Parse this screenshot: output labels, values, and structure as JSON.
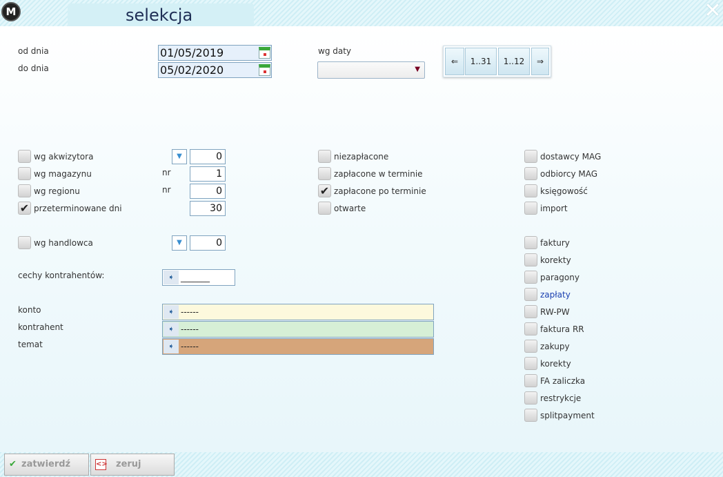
{
  "window": {
    "title": "selekcja",
    "logo_text": "M",
    "close_glyph": "✕"
  },
  "dates": {
    "from_label": "od dnia",
    "from_value": "01/05/2019",
    "to_label": "do dnia",
    "to_value": "05/02/2020",
    "by_date_label": "wg daty",
    "by_date_value": ""
  },
  "nav": {
    "prev": "⇐",
    "days": "1..31",
    "months": "1..12",
    "next": "⇒"
  },
  "filters_left": {
    "akwizytor": {
      "label": "wg akwizytora",
      "value": "0",
      "checked": false
    },
    "magazyn": {
      "label": "wg magazynu",
      "nr_label": "nr",
      "value": "1",
      "checked": false
    },
    "region": {
      "label": "wg regionu",
      "nr_label": "nr",
      "value": "0",
      "checked": false
    },
    "przeterminowane": {
      "label": "przeterminowane dni",
      "value": "30",
      "checked": true
    },
    "handlowiec": {
      "label": "wg handlowca",
      "value": "0",
      "checked": false
    }
  },
  "filters_middle": {
    "niezaplacone": {
      "label": "niezapłacone",
      "checked": false
    },
    "zaplacone_w_terminie": {
      "label": "zapłacone w terminie",
      "checked": false
    },
    "zaplacone_po_terminie": {
      "label": "zapłacone po terminie",
      "checked": true
    },
    "otwarte": {
      "label": "otwarte",
      "checked": false
    }
  },
  "filters_right_top": [
    {
      "label": "dostawcy MAG",
      "checked": false
    },
    {
      "label": "odbiorcy MAG",
      "checked": false
    },
    {
      "label": "księgowość",
      "checked": false
    },
    {
      "label": "import",
      "checked": false
    }
  ],
  "filters_right_docs": [
    {
      "label": "faktury",
      "checked": false
    },
    {
      "label": "korekty",
      "checked": false
    },
    {
      "label": "paragony",
      "checked": false
    },
    {
      "label": "zapłaty",
      "checked": false
    },
    {
      "label": "RW-PW",
      "checked": false
    },
    {
      "label": "faktura RR",
      "checked": false
    },
    {
      "label": "zakupy",
      "checked": false
    },
    {
      "label": "korekty",
      "checked": false
    },
    {
      "label": "FA zaliczka",
      "checked": false
    },
    {
      "label": "restrykcje",
      "checked": false
    },
    {
      "label": "splitpayment",
      "checked": false
    }
  ],
  "cechy": {
    "label": "cechy kontrahentów:",
    "value": "_______"
  },
  "konto": {
    "label": "konto",
    "value": "------",
    "color": "#fdf9dd"
  },
  "kontrahent": {
    "label": "kontrahent",
    "value": "------",
    "color": "#d6efd6"
  },
  "temat": {
    "label": "temat",
    "value": "------",
    "color": "#d6a57a"
  },
  "icons": {
    "check": "✔",
    "dropdown": "▼",
    "tag": "➧",
    "select_arrow": "▼"
  },
  "buttons": {
    "confirm": "zatwierdź",
    "reset": "zeruj"
  }
}
